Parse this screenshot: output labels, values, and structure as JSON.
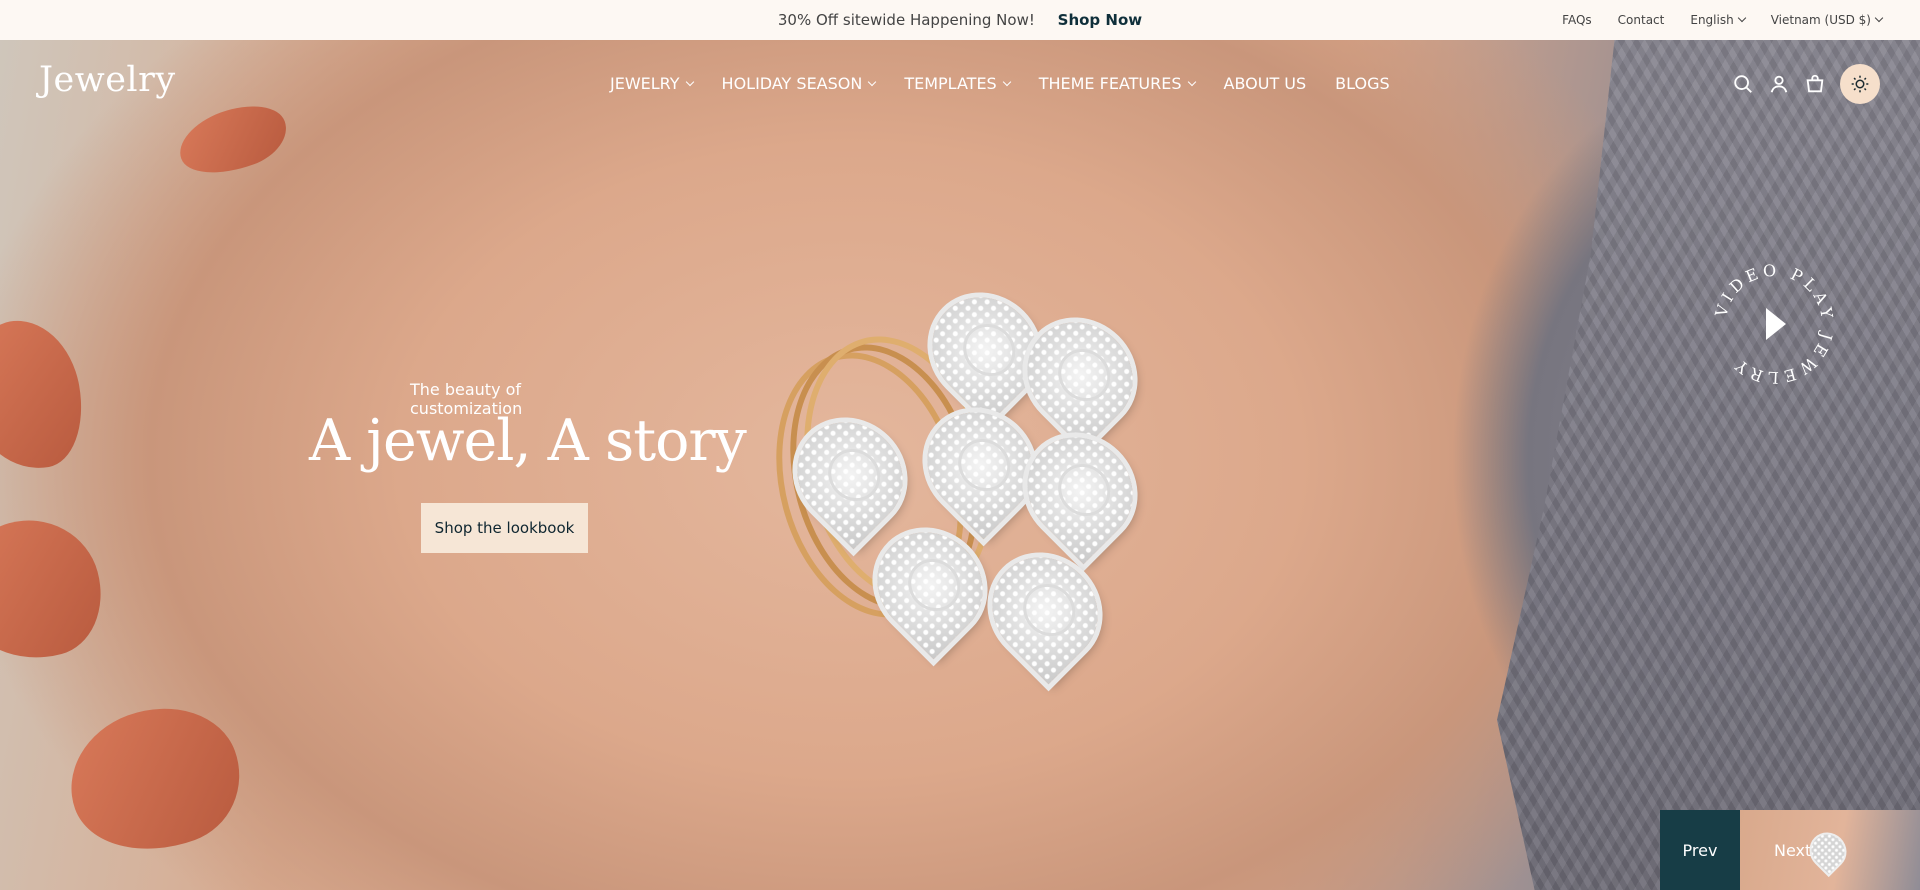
{
  "announcement": {
    "text": "30% Off sitewide Happening Now!",
    "link": "Shop Now",
    "faqs": "FAQs",
    "contact": "Contact",
    "language": "English",
    "currency": "Vietnam (USD $)"
  },
  "header": {
    "logo": "Jewelry",
    "nav": [
      "JEWELRY",
      "HOLIDAY SEASON",
      "TEMPLATES",
      "THEME FEATURES",
      "ABOUT US",
      "BLOGS"
    ],
    "icons": [
      "search-icon",
      "account-icon",
      "cart-icon",
      "sun-icon"
    ]
  },
  "hero": {
    "subtitle": "The beauty of customization",
    "headline": "A jewel, A story",
    "cta": "Shop the lookbook",
    "video_label": "VIDEO PLAY JEWELRY"
  },
  "slider": {
    "prev": "Prev",
    "next": "Next"
  },
  "colors": {
    "cta_bg": "#f6e6d6",
    "prev_bg": "#173d46",
    "theme_btn_bg": "#f6dfcb",
    "topbar_bg": "#fdf8f3",
    "shop_now": "#0f2f3a"
  }
}
